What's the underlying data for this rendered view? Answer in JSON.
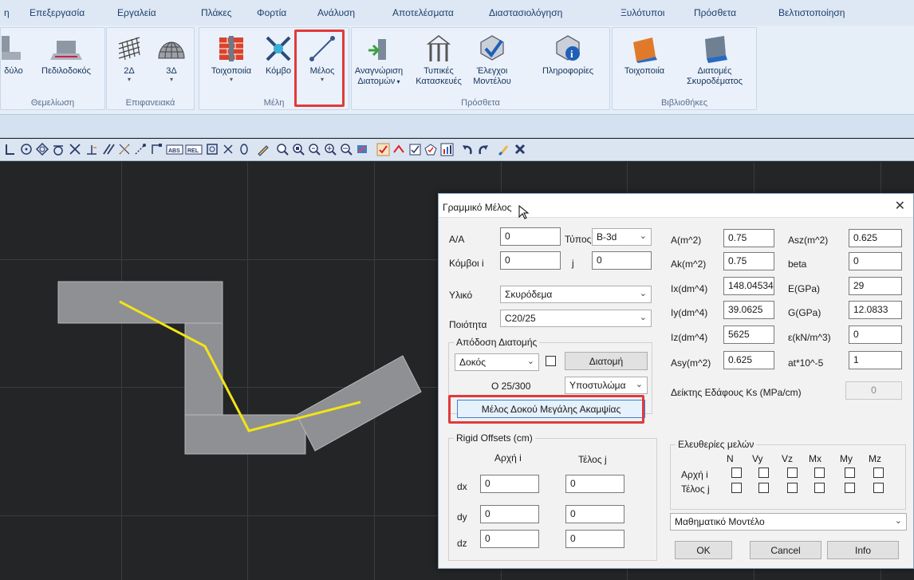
{
  "menu": [
    "η",
    "Επεξεργασία",
    "Εργαλεία",
    "Πλάκες",
    "Φορτία",
    "Ανάλυση",
    "Αποτελέσματα",
    "Διαστασιολόγηση",
    "Ξυλότυποι",
    "Πρόσθετα",
    "Βελτιστοποίηση"
  ],
  "ribbon": {
    "groups": [
      "Θεμελίωση",
      "Επιφανειακά",
      "Μέλη",
      "Πρόσθετα",
      "Βιβλιοθήκες"
    ],
    "buttons": {
      "b1": "δύλο",
      "b2": "Πεδιλοδοκός",
      "b3": "2Δ",
      "b4": "3Δ",
      "b5": "Τοιχοποιία",
      "b6": "Κόμβο",
      "b7": "Μέλος",
      "b8a": "Αναγνώριση",
      "b8b": "Διατομών",
      "b9a": "Τυπικές",
      "b9b": "Κατασκευές",
      "b10a": "Έλεγχοι",
      "b10b": "Μοντέλου",
      "b11": "Πληροφορίες",
      "b12": "Τοιχοποιία",
      "b13a": "Διατομές",
      "b13b": "Σκυροδέματος"
    }
  },
  "dialog": {
    "title": "Γραμμικό Μέλος",
    "aa_label": "Α/Α",
    "aa_value": "0",
    "type_label": "Τύπος",
    "type_value": "B-3d",
    "nodes_label": "Κόμβοι i",
    "node_i": "0",
    "j_label": "j",
    "node_j": "0",
    "material_label": "Υλικό",
    "material_value": "Σκυρόδεμα",
    "quality_label": "Ποιότητα",
    "quality_value": "C20/25",
    "section_group": "Απόδοση Διατομής",
    "section_type": "Δοκός",
    "section_button": "Διατομή",
    "section_desc": "Ο 25/300",
    "column_select": "Υποστυλώμα",
    "beam_button": "Μέλος Δοκού Μεγάλης Ακαμψίας",
    "props": [
      {
        "label": "A(m^2)",
        "value": "0.75"
      },
      {
        "label": "Ak(m^2)",
        "value": "0.75"
      },
      {
        "label": "Ix(dm^4)",
        "value": "148.04534"
      },
      {
        "label": "Iy(dm^4)",
        "value": "39.0625"
      },
      {
        "label": "Iz(dm^4)",
        "value": "5625"
      },
      {
        "label": "Asy(m^2)",
        "value": "0.625"
      }
    ],
    "props2": [
      {
        "label": "Asz(m^2)",
        "value": "0.625"
      },
      {
        "label": "beta",
        "value": "0"
      },
      {
        "label": "E(GPa)",
        "value": "29"
      },
      {
        "label": "G(GPa)",
        "value": "12.0833"
      },
      {
        "label": "ε(kN/m^3)",
        "value": "0"
      },
      {
        "label": "at*10^-5",
        "value": "1"
      }
    ],
    "ks_label": "Δείκτης Εδάφους Ks (MPa/cm)",
    "ks_value": "0",
    "offsets": {
      "title": "Rigid Offsets (cm)",
      "start": "Αρχή i",
      "end": "Τέλος j",
      "dx": "dx",
      "dy": "dy",
      "dz": "dz",
      "dx_i": "0",
      "dy_i": "0",
      "dz_i": "0",
      "dx_j": "0",
      "dy_j": "0",
      "dz_j": "0"
    },
    "releases": {
      "title": "Ελευθερίες μελών",
      "cols": [
        "N",
        "Vy",
        "Vz",
        "Mx",
        "My",
        "Mz"
      ],
      "start": "Αρχή i",
      "end": "Τέλος j"
    },
    "model_select": "Μαθηματικό Μοντέλο",
    "ok": "OK",
    "cancel": "Cancel",
    "info": "Info",
    "close": "✕"
  }
}
